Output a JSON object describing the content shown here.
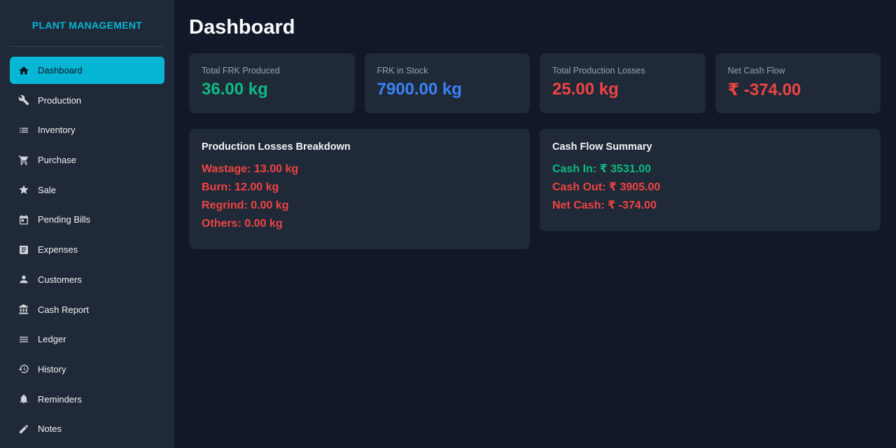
{
  "app": {
    "brand": "PLANT MANAGEMENT"
  },
  "colors": {
    "accent": "#06b6d4",
    "green": "#10b981",
    "blue": "#3b82f6",
    "red": "#ef4444",
    "bg": "#111827",
    "card": "#1f2937"
  },
  "sidebar": {
    "items": [
      {
        "label": "Dashboard",
        "icon": "home-icon",
        "active": true
      },
      {
        "label": "Production",
        "icon": "wrench-icon"
      },
      {
        "label": "Inventory",
        "icon": "list-icon"
      },
      {
        "label": "Purchase",
        "icon": "cart-icon"
      },
      {
        "label": "Sale",
        "icon": "star-icon"
      },
      {
        "label": "Pending Bills",
        "icon": "calendar-icon"
      },
      {
        "label": "Expenses",
        "icon": "document-icon"
      },
      {
        "label": "Customers",
        "icon": "person-icon"
      },
      {
        "label": "Cash Report",
        "icon": "bank-icon"
      },
      {
        "label": "Ledger",
        "icon": "menu-icon"
      },
      {
        "label": "History",
        "icon": "history-icon"
      },
      {
        "label": "Reminders",
        "icon": "bell-icon"
      },
      {
        "label": "Notes",
        "icon": "pencil-icon"
      }
    ]
  },
  "main": {
    "title": "Dashboard",
    "stats": [
      {
        "label": "Total FRK Produced",
        "value": "36.00 kg",
        "color": "#10b981"
      },
      {
        "label": "FRK in Stock",
        "value": "7900.00 kg",
        "color": "#3b82f6"
      },
      {
        "label": "Total Production Losses",
        "value": "25.00 kg",
        "color": "#ef4444"
      },
      {
        "label": "Net Cash Flow",
        "value": "₹ -374.00",
        "color": "#ef4444"
      }
    ],
    "losses": {
      "title": "Production Losses Breakdown",
      "lines": [
        {
          "text": "Wastage: 13.00 kg",
          "color": "#ef4444"
        },
        {
          "text": "Burn: 12.00 kg",
          "color": "#ef4444"
        },
        {
          "text": "Regrind: 0.00 kg",
          "color": "#ef4444"
        },
        {
          "text": "Others: 0.00 kg",
          "color": "#ef4444"
        }
      ]
    },
    "cashflow": {
      "title": "Cash Flow Summary",
      "lines": [
        {
          "text": "Cash In: ₹ 3531.00",
          "color": "#10b981"
        },
        {
          "text": "Cash Out: ₹ 3905.00",
          "color": "#ef4444"
        },
        {
          "text": "Net Cash: ₹ -374.00",
          "color": "#ef4444"
        }
      ]
    }
  }
}
